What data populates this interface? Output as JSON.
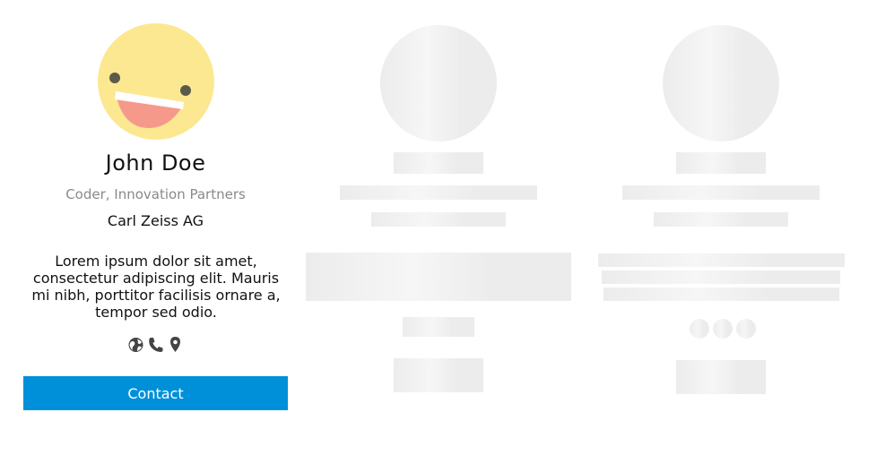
{
  "profile": {
    "name": "John Doe",
    "role": "Coder, Innovation Partners",
    "company": "Carl Zeiss AG",
    "bio": "Lorem ipsum dolor sit amet, consectetur adipiscing elit. Mauris mi nibh, porttitor facilisis ornare a, tempor sed odio.",
    "avatar_icon": "smiley-face-avatar",
    "links": [
      {
        "icon": "globe-icon"
      },
      {
        "icon": "phone-icon"
      },
      {
        "icon": "location-pin-icon"
      }
    ],
    "contact_label": "Contact"
  },
  "colors": {
    "accent": "#0090d9",
    "subtitle": "#8a8a8a",
    "skeleton": "#ececec",
    "avatar_face": "#fce891",
    "avatar_mouth": "#f59a8a"
  },
  "skeleton_cards": [
    {
      "state": "loading"
    },
    {
      "state": "loading"
    }
  ]
}
